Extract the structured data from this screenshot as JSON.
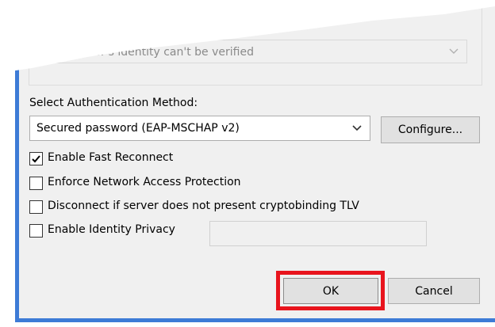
{
  "server_identity_dropdown": {
    "value": "the server's identity can't be verified"
  },
  "auth_method": {
    "label": "Select Authentication Method:",
    "selected": "Secured password (EAP-MSCHAP v2)",
    "configure_label": "Configure..."
  },
  "options": [
    {
      "label": "Enable Fast Reconnect",
      "checked": true
    },
    {
      "label": "Enforce Network Access Protection",
      "checked": false
    },
    {
      "label": "Disconnect if server does not present cryptobinding TLV",
      "checked": false
    },
    {
      "label": "Enable Identity Privacy",
      "checked": false
    }
  ],
  "identity_privacy_value": "",
  "buttons": {
    "ok_label": "OK",
    "cancel_label": "Cancel"
  },
  "colors": {
    "window_border": "#3d7bd6",
    "highlight": "#e8141d",
    "dialog_bg": "#f0f0f0"
  }
}
